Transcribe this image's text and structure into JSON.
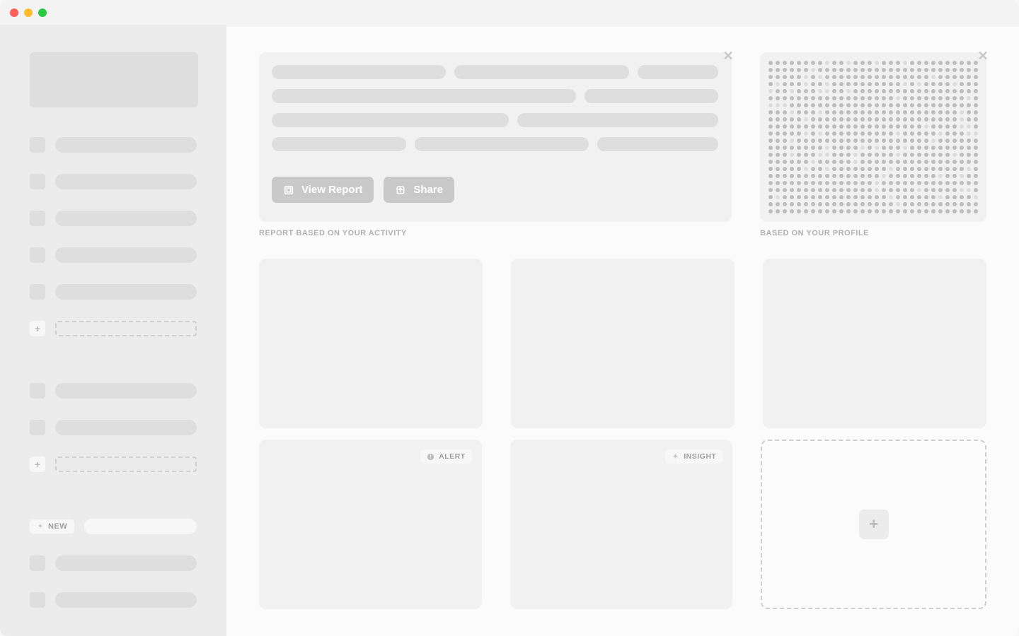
{
  "hero": {
    "view_report_label": "View Report",
    "share_label": "Share",
    "caption": "REPORT BASED ON YOUR ACTIVITY"
  },
  "profile_card": {
    "caption": "BASED ON YOUR PROFILE"
  },
  "sidebar": {
    "new_badge_label": "NEW"
  },
  "cards": {
    "alert_badge": "ALERT",
    "insight_badge": "INSIGHT"
  }
}
